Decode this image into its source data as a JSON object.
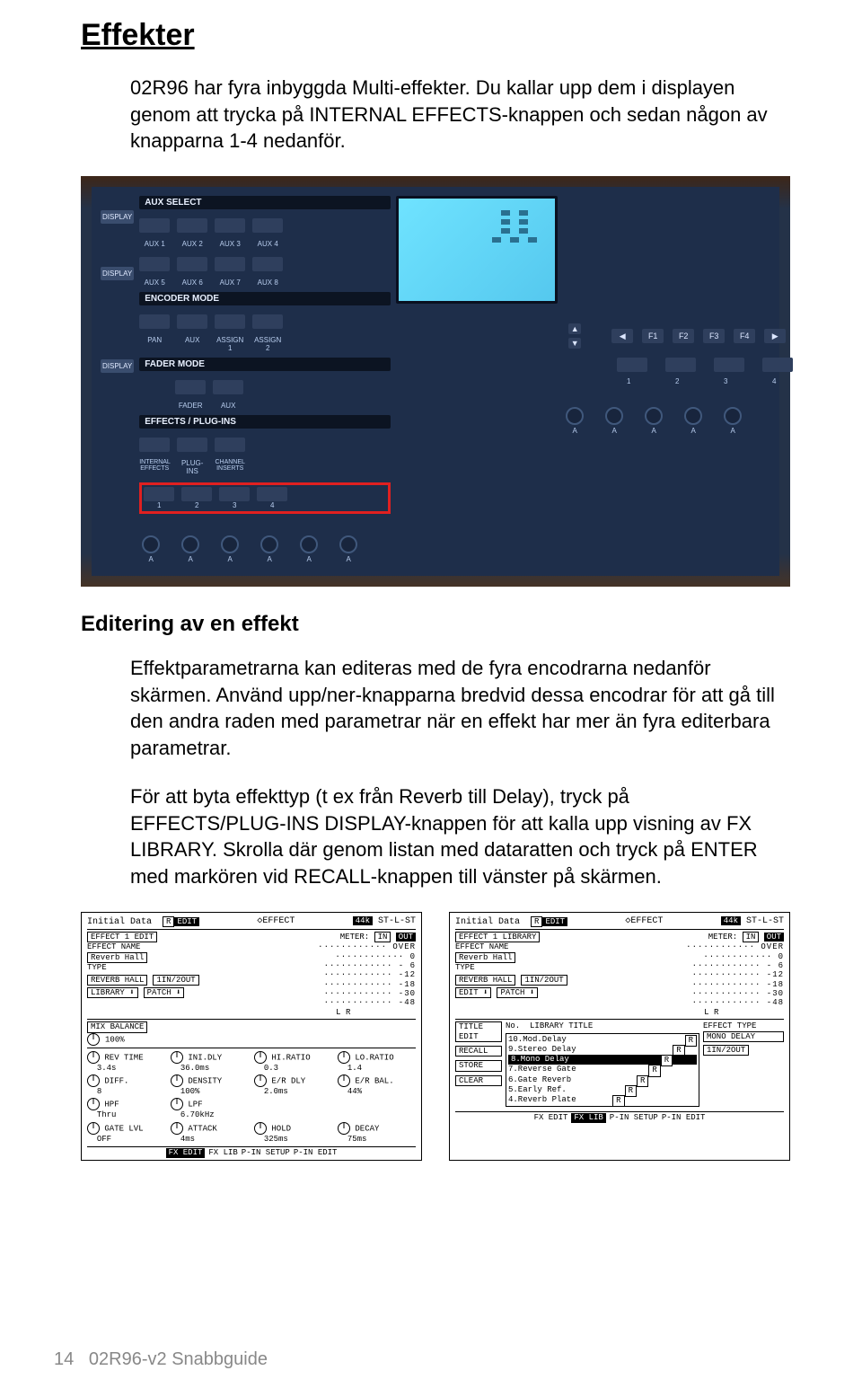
{
  "title": "Effekter",
  "intro": "02R96 har fyra inbyggda Multi-effekter. Du kallar upp dem i displayen genom att trycka på INTERNAL EFFECTS-knappen och sedan någon av knapparna 1-4 nedanför.",
  "subheading": "Editering av en effekt",
  "para1": "Effektparametrarna kan editeras med de fyra encodrarna nedanför skärmen. Använd upp/ner-knapparna bredvid dessa encodrar för att gå till den andra raden med parametrar när en effekt har mer än fyra editerbara parametrar.",
  "para2": "För att byta effekttyp (t ex från Reverb till Delay), tryck på EFFECTS/PLUG-INS DISPLAY-knappen för att kalla upp visning av FX LIBRARY. Skrolla där genom listan med dataratten och tryck på ENTER med markören vid RECALL-knappen till vänster på skärmen.",
  "footer_page": "14",
  "footer_doc": "02R96-v2 Snabbguide",
  "panel": {
    "display_label": "DISPLAY",
    "sections": {
      "aux": "AUX SELECT",
      "enc": "ENCODER MODE",
      "fader": "FADER MODE",
      "fx": "EFFECTS / PLUG-INS"
    },
    "aux_row1": [
      "AUX 1",
      "AUX 2",
      "AUX 3",
      "AUX 4"
    ],
    "aux_row2": [
      "AUX 5",
      "AUX 6",
      "AUX 7",
      "AUX 8"
    ],
    "enc_row": [
      "PAN",
      "AUX",
      "ASSIGN 1",
      "ASSIGN 2"
    ],
    "fader_row": [
      "FADER",
      "AUX"
    ],
    "fx_row1": [
      "INTERNAL EFFECTS",
      "PLUG-INS",
      "CHANNEL INSERTS"
    ],
    "fx_nums": [
      "1",
      "2",
      "3",
      "4"
    ],
    "nav": {
      "left": "◀",
      "f1": "F1",
      "f2": "F2",
      "f3": "F3",
      "f4": "F4",
      "right": "▶"
    },
    "enc_nums": [
      "1",
      "2",
      "3",
      "4"
    ],
    "arrows": {
      "up": "▲",
      "down": "▼"
    }
  },
  "lcd_left": {
    "top_title": "Initial Data",
    "top_r": "R",
    "top_edit": "EDIT",
    "top_eff": "◇EFFECT",
    "top_rate": "44k",
    "top_io": "ST-L-ST",
    "header": "EFFECT 1 EDIT",
    "meter_label": "METER:",
    "meter_in": "IN",
    "meter_out": "OUT",
    "name_lbl": "EFFECT NAME",
    "name_val": "Reverb Hall",
    "type_lbl": "TYPE",
    "type_val": "REVERB HALL",
    "io": "1IN/2OUT",
    "lib_btns": [
      "LIBRARY ⬇",
      "PATCH ⬇"
    ],
    "mix_lbl": "MIX BALANCE",
    "mix_val": "100%",
    "meter_scale": [
      "OVER",
      "0",
      "- 6",
      "-12",
      "-18",
      "-30",
      "-48"
    ],
    "lr": "L R",
    "params": [
      {
        "n": "REV TIME",
        "v": "3.4s"
      },
      {
        "n": "INI.DLY",
        "v": "36.0ms"
      },
      {
        "n": "HI.RATIO",
        "v": "0.3"
      },
      {
        "n": "LO.RATIO",
        "v": "1.4"
      },
      {
        "n": "DIFF.",
        "v": "8"
      },
      {
        "n": "DENSITY",
        "v": "100%"
      },
      {
        "n": "E/R DLY",
        "v": "2.0ms"
      },
      {
        "n": "E/R BAL.",
        "v": "44%"
      },
      {
        "n": "HPF",
        "v": "Thru"
      },
      {
        "n": "LPF",
        "v": "6.70kHz"
      },
      {
        "n": "GATE LVL",
        "v": "OFF"
      },
      {
        "n": "ATTACK",
        "v": "4ms"
      },
      {
        "n": "HOLD",
        "v": "325ms"
      },
      {
        "n": "DECAY",
        "v": "75ms"
      }
    ],
    "tabs": [
      "FX EDIT",
      "FX LIB",
      "P-IN SETUP",
      "P-IN EDIT"
    ]
  },
  "lcd_right": {
    "top_title": "Initial Data",
    "top_r": "R",
    "top_edit": "EDIT",
    "top_eff": "◇EFFECT",
    "top_rate": "44k",
    "top_io": "ST-L-ST",
    "header": "EFFECT 1 LIBRARY",
    "meter_label": "METER:",
    "meter_in": "IN",
    "meter_out": "OUT",
    "name_lbl": "EFFECT NAME",
    "name_val": "Reverb Hall",
    "type_lbl": "TYPE",
    "type_val": "REVERB HALL",
    "io": "1IN/2OUT",
    "btns": [
      "EDIT ⬇",
      "PATCH ⬇"
    ],
    "side_btns": [
      "TITLE EDIT",
      "RECALL",
      "STORE",
      "CLEAR"
    ],
    "list_hdr_no": "No.",
    "list_hdr_title": "LIBRARY TITLE",
    "list": [
      "10.Mod.Delay",
      " 9.Stereo Delay",
      " 8.Mono Delay",
      " 7.Reverse Gate",
      " 6.Gate Reverb",
      " 5.Early Ref.",
      " 4.Reverb Plate"
    ],
    "eff_type_lbl": "EFFECT TYPE",
    "eff_type_val": "MONO DELAY",
    "eff_io": "1IN/2OUT",
    "meter_scale": [
      "OVER",
      "0",
      "- 6",
      "-12",
      "-18",
      "-30",
      "-48"
    ],
    "lr": "L R",
    "tabs": [
      "FX EDIT",
      "FX LIB",
      "P-IN SETUP",
      "P-IN EDIT"
    ]
  }
}
